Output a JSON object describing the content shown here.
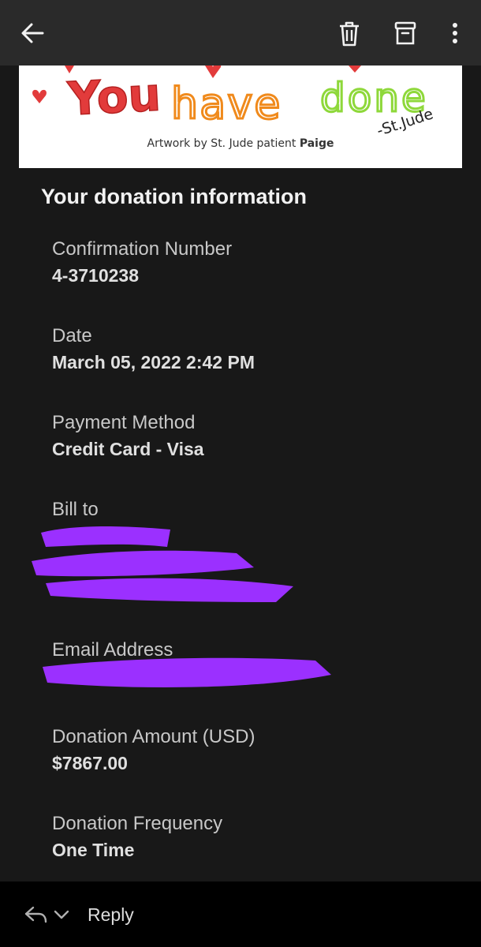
{
  "toolbar": {
    "back_icon": "arrow-left-icon",
    "delete_icon": "trash-icon",
    "archive_icon": "archive-icon",
    "more_icon": "more-vertical-icon"
  },
  "banner": {
    "art_text": [
      "You",
      "have",
      "done",
      "-St.Jude"
    ],
    "caption_prefix": "Artwork by St. Jude patient",
    "caption_name": "Paige"
  },
  "section_title": "Your donation information",
  "fields": {
    "confirmation": {
      "label": "Confirmation Number",
      "value": "4-3710238"
    },
    "date": {
      "label": "Date",
      "value": "March 05, 2022 2:42 PM"
    },
    "payment": {
      "label": "Payment Method",
      "value": "Credit Card - Visa"
    },
    "bill_to": {
      "label": "Bill to"
    },
    "email": {
      "label": "Email Address"
    },
    "amount": {
      "label": "Donation Amount (USD)",
      "value": "$7867.00"
    },
    "frequency": {
      "label": "Donation Frequency",
      "value": "One Time"
    }
  },
  "bottom": {
    "reply_label": "Reply",
    "reply_icon": "reply-icon",
    "expand_icon": "chevron-down-icon"
  },
  "colors": {
    "redaction": "#9b30ff",
    "toolbar_bg": "#2a2a2a",
    "content_bg": "#181818"
  }
}
